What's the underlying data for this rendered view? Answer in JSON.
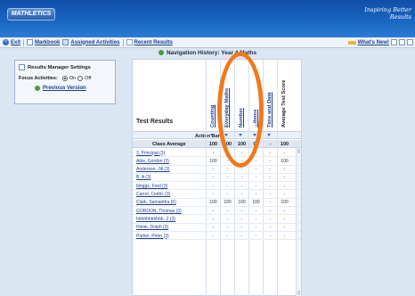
{
  "header": {
    "logo": "MATHLETICS",
    "tagline": "Inspiring Better Results"
  },
  "toolbar": {
    "exit": "Exit",
    "markbook": "Markbook",
    "assigned": "Assigned Activities",
    "recent": "Recent Results",
    "whats_new": "What's New!"
  },
  "navigation": {
    "label": "Navigation History: Year 4 Maths"
  },
  "settings": {
    "title": "Results Manager Settings",
    "focus_label": "Focus Activities:",
    "on": "On",
    "off": "Off",
    "focus_selected": "On",
    "previous_version": "Previous Version"
  },
  "table": {
    "title": "Test Results",
    "columns": [
      "Counting",
      "Everyday Maths",
      "Number",
      "...ttems",
      "Time and Data",
      "Average Test Score"
    ],
    "action_bar_label": "Action Bar",
    "class_average": {
      "label": "Class Average",
      "values": [
        "100",
        "100",
        "100",
        "00",
        "-",
        "100"
      ]
    },
    "rows": [
      {
        "name": "3, Principal (3)",
        "values": [
          "-",
          "-",
          "-",
          "-",
          "-",
          "-"
        ]
      },
      {
        "name": "Able, Gordon (3)",
        "values": [
          "100",
          "-",
          "-",
          "-",
          "-",
          "100"
        ]
      },
      {
        "name": "Anderson, Jill (3)",
        "values": [
          "-",
          "-",
          "-",
          "-",
          "-",
          "-"
        ]
      },
      {
        "name": "B, A (3)",
        "values": [
          "-",
          "-",
          "-",
          "-",
          "-",
          "-"
        ]
      },
      {
        "name": "bloggs, Fred (3)",
        "values": [
          "-",
          "-",
          "-",
          "-",
          "-",
          "-"
        ]
      },
      {
        "name": "Carrol, Cedric (3)",
        "values": [
          "-",
          "-",
          "-",
          "-",
          "-",
          "-"
        ]
      },
      {
        "name": "Clark, Samantha (6)",
        "values": [
          "100",
          "100",
          "100",
          "100",
          "-",
          "100"
        ]
      },
      {
        "name": "GORDON, Thomas (3)",
        "values": [
          "-",
          "-",
          "-",
          "-",
          "-",
          "-"
        ]
      },
      {
        "name": "hhhhhhhhhhh, Z (3)",
        "values": [
          "-",
          "-",
          "-",
          "-",
          "-",
          "-"
        ]
      },
      {
        "name": "Hinnk, Dolph (3)",
        "values": [
          "-",
          "-",
          "-",
          "-",
          "-",
          "-"
        ]
      },
      {
        "name": "Parker, Peter (3)",
        "values": [
          "-",
          "-",
          "-",
          "-",
          "-",
          "-"
        ]
      }
    ]
  },
  "colors": {
    "banner": "#1a67c4",
    "link": "#1a3f8f",
    "annotation": "#f07a1a"
  }
}
